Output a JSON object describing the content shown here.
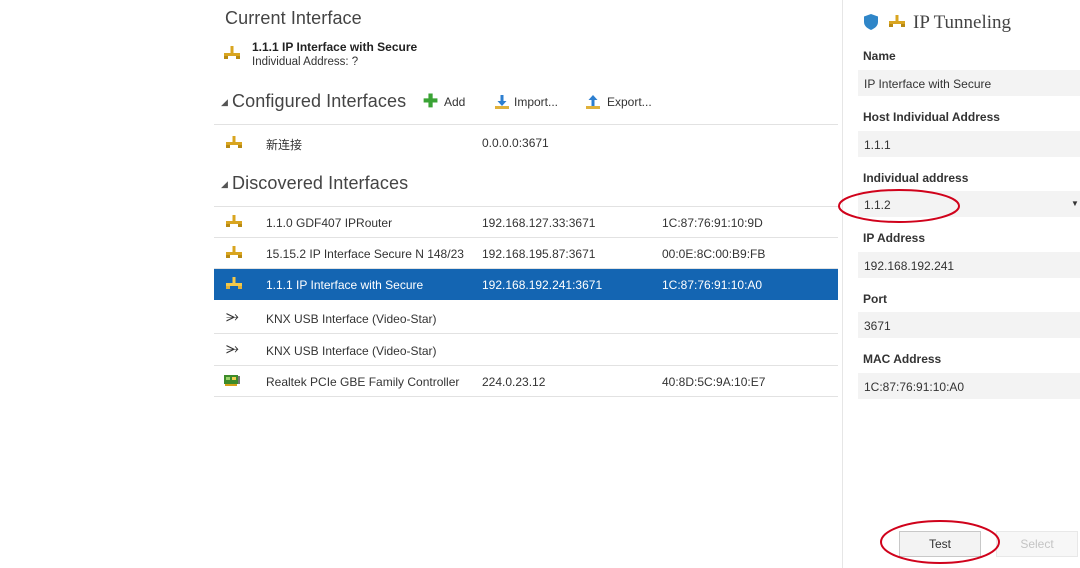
{
  "current": {
    "title": "Current Interface",
    "name": "1.1.1 IP Interface with Secure",
    "address": "Individual Address: ?"
  },
  "configured": {
    "title": "Configured Interfaces",
    "add": "Add",
    "import": "Import...",
    "export": "Export...",
    "rows": [
      {
        "name": "新连接",
        "address": "0.0.0.0:3671",
        "mac": ""
      }
    ]
  },
  "discovered": {
    "title": "Discovered Interfaces",
    "rows": [
      {
        "name": "1.1.0 GDF407 IPRouter",
        "address": "192.168.127.33:3671",
        "mac": "1C:87:76:91:10:9D",
        "icon": "ip-network-icon"
      },
      {
        "name": "15.15.2 IP Interface Secure N 148/23",
        "address": "192.168.195.87:3671",
        "mac": "00:0E:8C:00:B9:FB",
        "icon": "ip-network-icon"
      },
      {
        "name": "1.1.1 IP Interface with Secure",
        "address": "192.168.192.241:3671",
        "mac": "1C:87:76:91:10:A0",
        "icon": "ip-network-icon",
        "selected": true
      },
      {
        "name": "KNX USB Interface (Video-Star)",
        "address": "",
        "mac": "",
        "icon": "usb-icon"
      },
      {
        "name": "KNX USB Interface (Video-Star)",
        "address": "",
        "mac": "",
        "icon": "usb-icon"
      },
      {
        "name": "Realtek PCIe GBE Family Controller",
        "address": "224.0.23.12",
        "mac": "40:8D:5C:9A:10:E7",
        "icon": "network-card-icon"
      }
    ]
  },
  "panel": {
    "title": "IP Tunneling",
    "name_label": "Name",
    "name_value": "IP Interface with Secure",
    "host_label": "Host Individual Address",
    "host_value": "1.1.1",
    "ind_label": "Individual address",
    "ind_value": "1.1.2",
    "ip_label": "IP Address",
    "ip_value": "192.168.192.241",
    "port_label": "Port",
    "port_value": "3671",
    "mac_label": "MAC Address",
    "mac_value": "1C:87:76:91:10:A0",
    "test": "Test",
    "select": "Select"
  },
  "colors": {
    "selection": "#1465b2",
    "annotation": "#d0021b",
    "add_green": "#3aa335",
    "import_blue": "#2d7fd0"
  }
}
